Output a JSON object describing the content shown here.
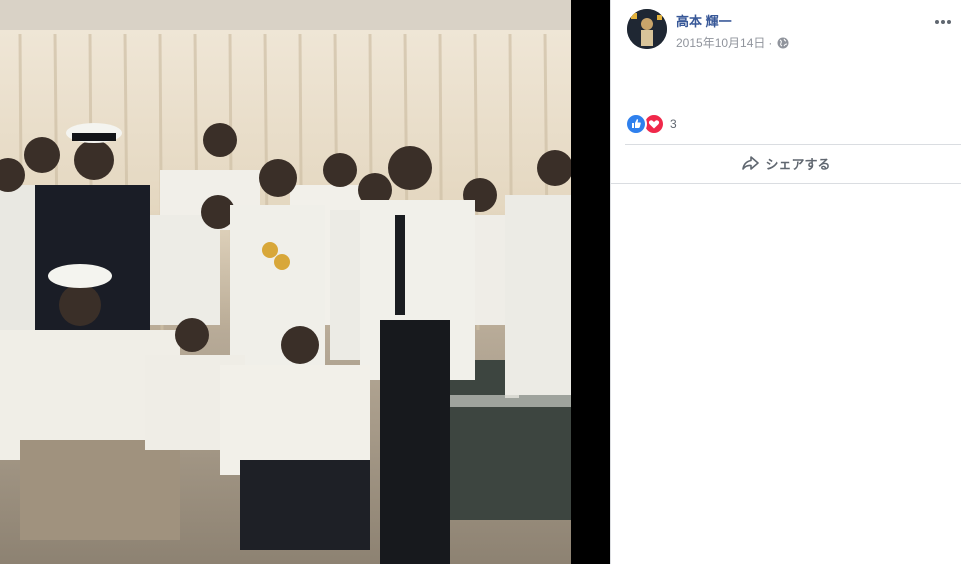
{
  "post": {
    "author_name": "高本 輝一",
    "date": "2015年10月14日",
    "separator": "·",
    "privacy_icon": "globe-icon",
    "more_icon": "more-options-icon"
  },
  "reactions": {
    "types": [
      "like",
      "love"
    ],
    "count": "3"
  },
  "actions": {
    "share_label": "シェアする"
  },
  "colors": {
    "author_link": "#385898",
    "meta_text": "#90949c",
    "like": "#2f80ed",
    "love": "#f0284a",
    "viewer_background": "#000000"
  }
}
